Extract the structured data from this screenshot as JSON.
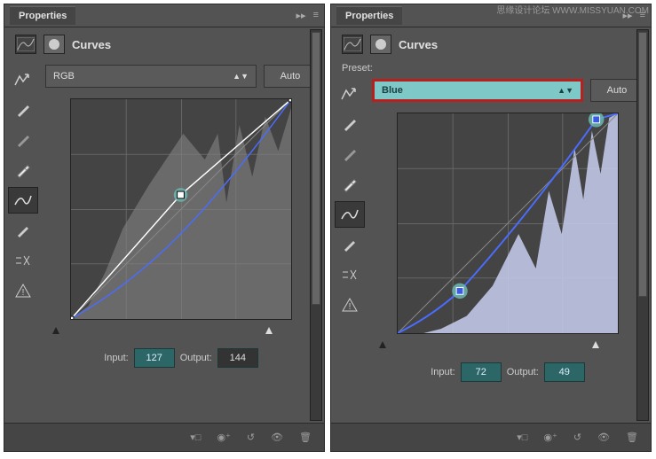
{
  "watermark": "思缘设计论坛 WWW.MISSYUAN.COM",
  "panel_left": {
    "title": "Properties",
    "type_label": "Curves",
    "preset_label": "",
    "channel": "RGB",
    "channel_highlighted": false,
    "auto_label": "Auto",
    "input_label": "Input:",
    "input_value": "127",
    "output_label": "Output:",
    "output_value": "144",
    "output_dark": true,
    "chart_data": {
      "type": "line",
      "xlabel": "Input",
      "ylabel": "Output",
      "xlim": [
        0,
        255
      ],
      "ylim": [
        0,
        255
      ],
      "histogram_fill": "#808080",
      "series": [
        {
          "name": "composite-curve",
          "color": "#fff",
          "values": [
            [
              0,
              0
            ],
            [
              127,
              144
            ],
            [
              255,
              255
            ]
          ]
        },
        {
          "name": "channel-curve",
          "color": "#4a6cff",
          "values": [
            [
              0,
              0
            ],
            [
              60,
              35
            ],
            [
              128,
              100
            ],
            [
              200,
              200
            ],
            [
              255,
              255
            ]
          ]
        }
      ],
      "control_point": {
        "x": 127,
        "y": 144
      }
    }
  },
  "panel_right": {
    "title": "Properties",
    "type_label": "Curves",
    "preset_label": "Preset:",
    "channel": "Blue",
    "channel_highlighted": true,
    "auto_label": "Auto",
    "input_label": "Input:",
    "input_value": "72",
    "output_label": "Output:",
    "output_value": "49",
    "output_dark": false,
    "chart_data": {
      "type": "line",
      "xlabel": "Input",
      "ylabel": "Output",
      "xlim": [
        0,
        255
      ],
      "ylim": [
        0,
        255
      ],
      "histogram_fill": "#c8cff0",
      "series": [
        {
          "name": "baseline",
          "color": "#888",
          "values": [
            [
              0,
              0
            ],
            [
              255,
              255
            ]
          ]
        },
        {
          "name": "blue-curve",
          "color": "#4a6cff",
          "values": [
            [
              0,
              0
            ],
            [
              72,
              49
            ],
            [
              230,
              248
            ],
            [
              255,
              255
            ]
          ]
        }
      ],
      "control_points": [
        {
          "x": 72,
          "y": 49
        },
        {
          "x": 230,
          "y": 248
        }
      ]
    }
  },
  "tools": [
    "hand-icon",
    "eyedropper-black-icon",
    "eyedropper-gray-icon",
    "eyedropper-white-icon",
    "curve-icon",
    "pencil-icon",
    "smooth-icon",
    "warning-icon"
  ],
  "footer_icons": [
    "clip-icon",
    "visibility-toggle-icon",
    "reset-icon",
    "eye-icon",
    "trash-icon"
  ]
}
